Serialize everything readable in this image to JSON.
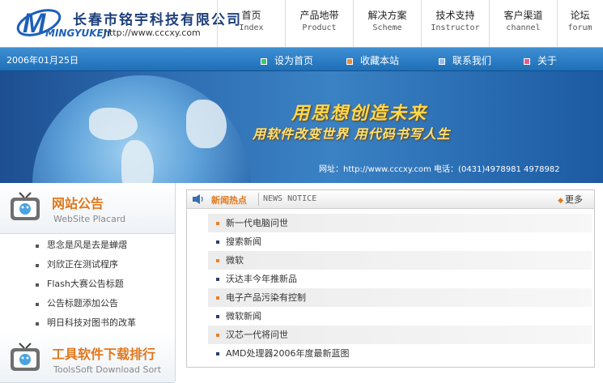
{
  "header": {
    "company_name": "长春市铭宇科技有限公司",
    "brand_en": "MINGYUKEJI",
    "url": "http://www.cccxy.com"
  },
  "nav": [
    {
      "cn": "首页",
      "en": "Index"
    },
    {
      "cn": "产品地带",
      "en": "Product"
    },
    {
      "cn": "解决方案",
      "en": "Scheme"
    },
    {
      "cn": "技术支持",
      "en": "Instructor"
    },
    {
      "cn": "客户渠道",
      "en": "channel"
    },
    {
      "cn": "论坛",
      "en": "forum"
    }
  ],
  "bar": {
    "date": "2006年01月25日",
    "links": [
      "设为首页",
      "收藏本站",
      "联系我们",
      "关于"
    ],
    "link_colors": [
      "#3fc46a",
      "#f08a2a",
      "#9ab8e8",
      "#e85a8a"
    ]
  },
  "banner": {
    "line1": "用思想创造未来",
    "line2": "用软件改变世界 用代码书写人生",
    "contact": "网址：http://www.cccxy.com 电话：(0431)4978981 4978982"
  },
  "placard": {
    "title": "网站公告",
    "subtitle": "WebSite Placard",
    "items": [
      "思念是风是去是蝉熠",
      "刘欣正在测试程序",
      "Flash大赛公告标题",
      "公告标题添加公告",
      "明日科技对图书的改革"
    ]
  },
  "tools": {
    "title": "工具软件下载排行",
    "subtitle": "ToolsSoft Download Sort"
  },
  "news": {
    "title": "新闻热点",
    "subtitle": "NEWS NOTICE",
    "more": "更多",
    "items": [
      "新一代电脑问世",
      "搜索新闻",
      "微软",
      "沃达丰今年推新品",
      "电子产品污染有控制",
      "微软新闻",
      "汉芯一代将问世",
      "AMD处理器2006年度最新蓝图"
    ]
  }
}
